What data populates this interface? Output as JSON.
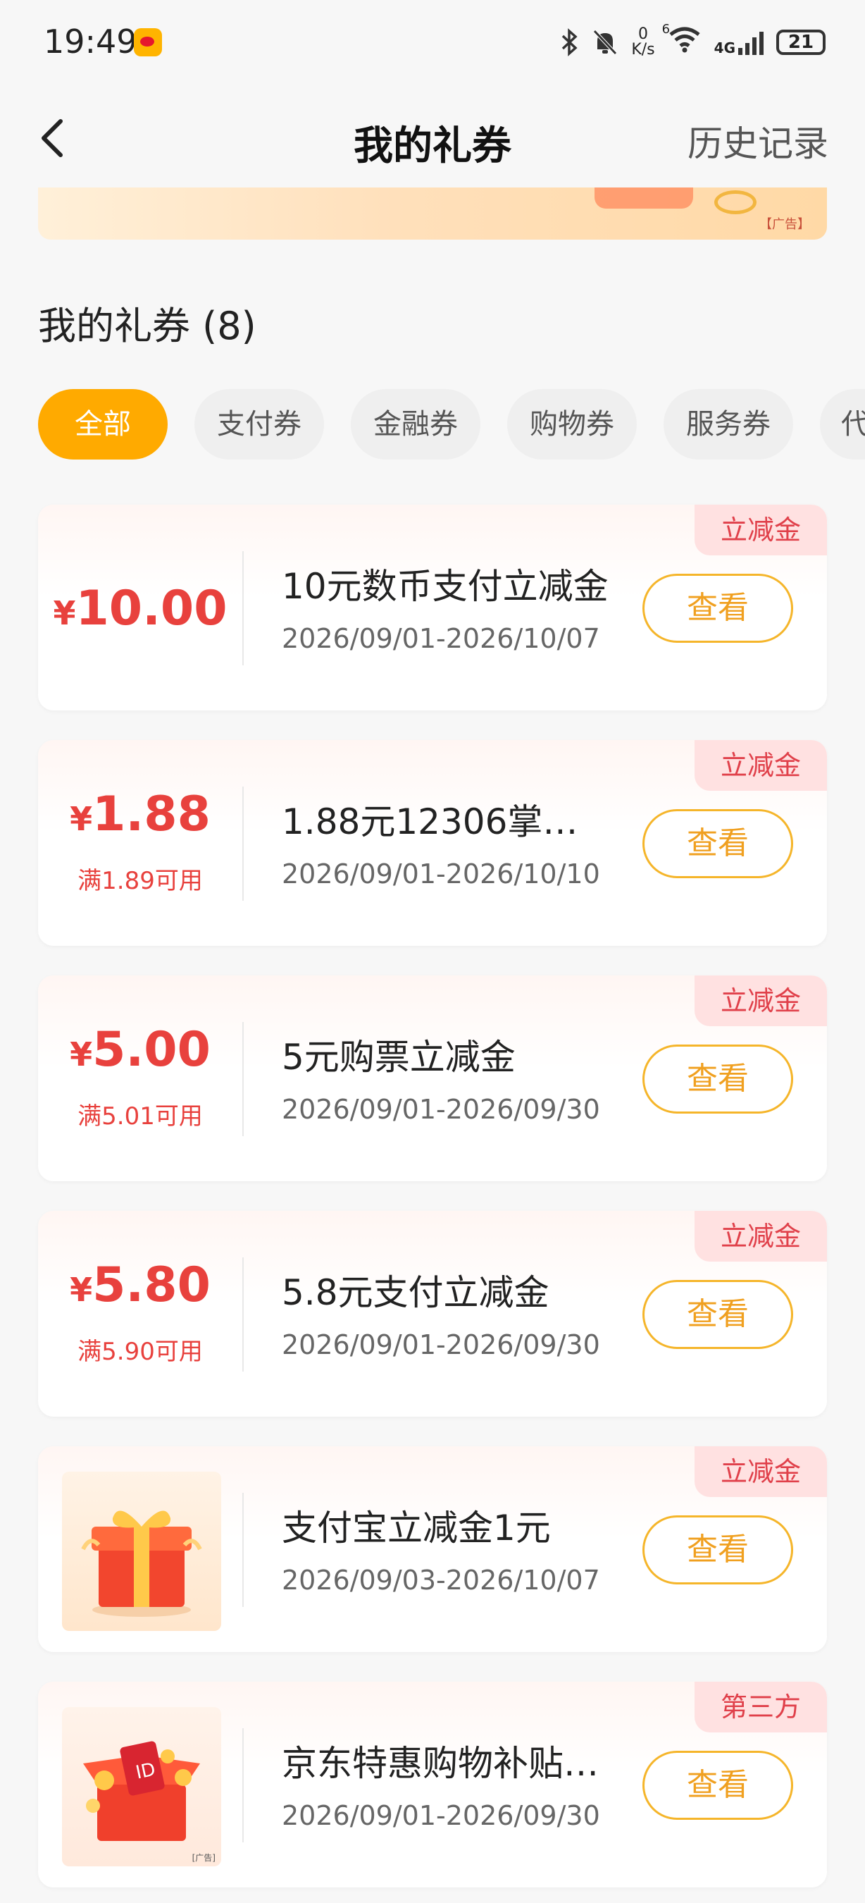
{
  "status_bar": {
    "time": "19:49",
    "net_speed_value": "0",
    "net_speed_unit": "K/s",
    "wifi_badge": "6",
    "network": "4G",
    "battery": "21"
  },
  "nav": {
    "title": "我的礼券",
    "history": "历史记录"
  },
  "banner": {
    "ad_label": "【广告】"
  },
  "section": {
    "title": "我的礼券 (8)"
  },
  "tabs": [
    {
      "label": "全部",
      "active": true
    },
    {
      "label": "支付券"
    },
    {
      "label": "金融券"
    },
    {
      "label": "购物券"
    },
    {
      "label": "服务券"
    },
    {
      "label": "代"
    }
  ],
  "coupons": [
    {
      "tag": "立减金",
      "currency": "¥",
      "amount": "10.00",
      "condition": "",
      "name": "10元数币支付立减金",
      "date": "2026/09/01-2026/10/07",
      "button": "查看"
    },
    {
      "tag": "立减金",
      "currency": "¥",
      "amount": "1.88",
      "condition": "满1.89可用",
      "name": "1.88元12306掌银…",
      "date": "2026/09/01-2026/10/10",
      "button": "查看"
    },
    {
      "tag": "立减金",
      "currency": "¥",
      "amount": "5.00",
      "condition": "满5.01可用",
      "name": "5元购票立减金",
      "date": "2026/09/01-2026/09/30",
      "button": "查看"
    },
    {
      "tag": "立减金",
      "currency": "¥",
      "amount": "5.80",
      "condition": "满5.90可用",
      "name": "5.8元支付立减金",
      "date": "2026/09/01-2026/09/30",
      "button": "查看"
    },
    {
      "tag": "立减金",
      "name": "支付宝立减金1元",
      "date": "2026/09/03-2026/10/07",
      "button": "查看"
    },
    {
      "tag": "第三方",
      "name": "京东特惠购物补贴…",
      "date": "2026/09/01-2026/09/30",
      "button": "查看",
      "image_ad_label": "[广告]"
    }
  ],
  "colors": {
    "accent": "#ffaa00",
    "price_red": "#e8413d",
    "button_border": "#f5b52a",
    "tag_bg": "#ffe1e1"
  }
}
